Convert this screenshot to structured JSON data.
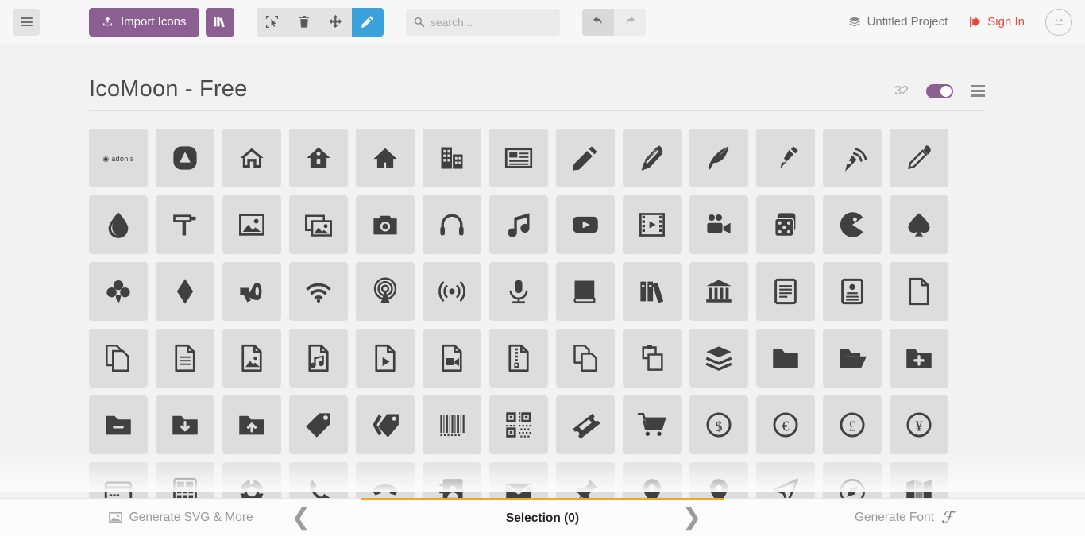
{
  "toolbar": {
    "menu_icon": "hamburger-icon",
    "import_label": "Import Icons",
    "import_icon": "upload-icon",
    "library_icon": "books-icon",
    "tools": [
      {
        "name": "select-tool",
        "icon": "cursor-select-icon",
        "active": false
      },
      {
        "name": "delete-tool",
        "icon": "trash-icon",
        "active": false
      },
      {
        "name": "move-tool",
        "icon": "move-arrows-icon",
        "active": false
      },
      {
        "name": "edit-tool",
        "icon": "pencil-icon",
        "active": true
      }
    ],
    "search_placeholder": "search...",
    "search_value": "",
    "search_icon": "search-icon",
    "undo_icon": "undo-arrow-icon",
    "redo_icon": "redo-arrow-icon",
    "project_label": "Untitled Project",
    "project_icon": "stack-layers-icon",
    "signin_label": "Sign In",
    "signin_icon": "login-icon",
    "avatar_icon": "neutral-face-icon",
    "accent_purple": "#8c5f93",
    "accent_blue": "#3ba1db",
    "accent_red": "#e8463a"
  },
  "set": {
    "title": "IcoMoon - Free",
    "count": "32",
    "toggle_on": true,
    "menu_icon": "set-menu-icon"
  },
  "icons": [
    {
      "name": "adonis-logo-icon",
      "glyph": "logo"
    },
    {
      "name": "icomoon-logo-icon",
      "glyph": "logo2"
    },
    {
      "name": "home-icon",
      "glyph": "home"
    },
    {
      "name": "home2-icon",
      "glyph": "home2"
    },
    {
      "name": "home3-icon",
      "glyph": "home3"
    },
    {
      "name": "office-icon",
      "glyph": "office"
    },
    {
      "name": "newspaper-icon",
      "glyph": "newspaper"
    },
    {
      "name": "pencil-icon",
      "glyph": "pencil"
    },
    {
      "name": "pencil2-icon",
      "glyph": "pencil2"
    },
    {
      "name": "quill-icon",
      "glyph": "quill"
    },
    {
      "name": "pen-icon",
      "glyph": "pen"
    },
    {
      "name": "blog-icon",
      "glyph": "blog"
    },
    {
      "name": "eyedropper-icon",
      "glyph": "eyedropper"
    },
    {
      "name": "droplet-icon",
      "glyph": "droplet"
    },
    {
      "name": "paint-format-icon",
      "glyph": "paint-format"
    },
    {
      "name": "image-icon",
      "glyph": "image"
    },
    {
      "name": "images-icon",
      "glyph": "images"
    },
    {
      "name": "camera-icon",
      "glyph": "camera"
    },
    {
      "name": "headphones-icon",
      "glyph": "headphones"
    },
    {
      "name": "music-icon",
      "glyph": "music"
    },
    {
      "name": "play-icon",
      "glyph": "play"
    },
    {
      "name": "film-icon",
      "glyph": "film"
    },
    {
      "name": "video-camera-icon",
      "glyph": "video-camera"
    },
    {
      "name": "dice-icon",
      "glyph": "dice"
    },
    {
      "name": "pacman-icon",
      "glyph": "pacman"
    },
    {
      "name": "spades-icon",
      "glyph": "spades"
    },
    {
      "name": "clubs-icon",
      "glyph": "clubs"
    },
    {
      "name": "diamonds-icon",
      "glyph": "diamonds"
    },
    {
      "name": "bullhorn-icon",
      "glyph": "bullhorn"
    },
    {
      "name": "connection-icon",
      "glyph": "connection"
    },
    {
      "name": "podcast-icon",
      "glyph": "podcast"
    },
    {
      "name": "feed-icon",
      "glyph": "feed"
    },
    {
      "name": "mic-icon",
      "glyph": "mic"
    },
    {
      "name": "book-icon",
      "glyph": "book"
    },
    {
      "name": "books-icon",
      "glyph": "books"
    },
    {
      "name": "library-icon",
      "glyph": "library"
    },
    {
      "name": "file-text-icon",
      "glyph": "file-text"
    },
    {
      "name": "profile-icon",
      "glyph": "profile"
    },
    {
      "name": "file-empty-icon",
      "glyph": "file-empty"
    },
    {
      "name": "files-empty-icon",
      "glyph": "files-empty"
    },
    {
      "name": "file-text2-icon",
      "glyph": "file-text2"
    },
    {
      "name": "file-picture-icon",
      "glyph": "file-picture"
    },
    {
      "name": "file-music-icon",
      "glyph": "file-music"
    },
    {
      "name": "file-play-icon",
      "glyph": "file-play"
    },
    {
      "name": "file-video-icon",
      "glyph": "file-video"
    },
    {
      "name": "file-zip-icon",
      "glyph": "file-zip"
    },
    {
      "name": "copy-icon",
      "glyph": "copy"
    },
    {
      "name": "paste-icon",
      "glyph": "paste"
    },
    {
      "name": "stack-icon",
      "glyph": "stack"
    },
    {
      "name": "folder-icon",
      "glyph": "folder"
    },
    {
      "name": "folder-open-icon",
      "glyph": "folder-open"
    },
    {
      "name": "folder-plus-icon",
      "glyph": "folder-plus"
    },
    {
      "name": "folder-minus-icon",
      "glyph": "folder-minus"
    },
    {
      "name": "folder-download-icon",
      "glyph": "folder-download"
    },
    {
      "name": "folder-upload-icon",
      "glyph": "folder-upload"
    },
    {
      "name": "price-tag-icon",
      "glyph": "price-tag"
    },
    {
      "name": "price-tags-icon",
      "glyph": "price-tags"
    },
    {
      "name": "barcode-icon",
      "glyph": "barcode"
    },
    {
      "name": "qrcode-icon",
      "glyph": "qrcode"
    },
    {
      "name": "ticket-icon",
      "glyph": "ticket"
    },
    {
      "name": "cart-icon",
      "glyph": "cart"
    },
    {
      "name": "coin-dollar-icon",
      "glyph": "coin-dollar"
    },
    {
      "name": "coin-euro-icon",
      "glyph": "coin-euro"
    },
    {
      "name": "coin-pound-icon",
      "glyph": "coin-pound"
    },
    {
      "name": "coin-yen-icon",
      "glyph": "coin-yen"
    },
    {
      "name": "credit-card-icon",
      "glyph": "credit-card"
    },
    {
      "name": "calculator-icon",
      "glyph": "calculator"
    },
    {
      "name": "lifebuoy-icon",
      "glyph": "lifebuoy"
    },
    {
      "name": "phone-icon",
      "glyph": "phone"
    },
    {
      "name": "phone-hang-up-icon",
      "glyph": "phone-hang-up"
    },
    {
      "name": "address-book-icon",
      "glyph": "address-book"
    },
    {
      "name": "envelop-icon",
      "glyph": "envelop"
    },
    {
      "name": "pushpin-icon",
      "glyph": "pushpin"
    },
    {
      "name": "location-icon",
      "glyph": "location"
    },
    {
      "name": "location2-icon",
      "glyph": "location2"
    },
    {
      "name": "compass-icon",
      "glyph": "compass"
    },
    {
      "name": "compass2-icon",
      "glyph": "compass2"
    },
    {
      "name": "map-icon",
      "glyph": "map"
    }
  ],
  "bottom": {
    "left_tab_label": "Generate SVG & More",
    "left_tab_icon": "image-icon",
    "center_tab_label": "Selection (0)",
    "right_tab_label": "Generate Font",
    "right_tab_icon": "font-f-icon",
    "chevron_left": "❮",
    "chevron_right": "❯",
    "active_tab": "center",
    "active_border_color": "#f5a623"
  }
}
